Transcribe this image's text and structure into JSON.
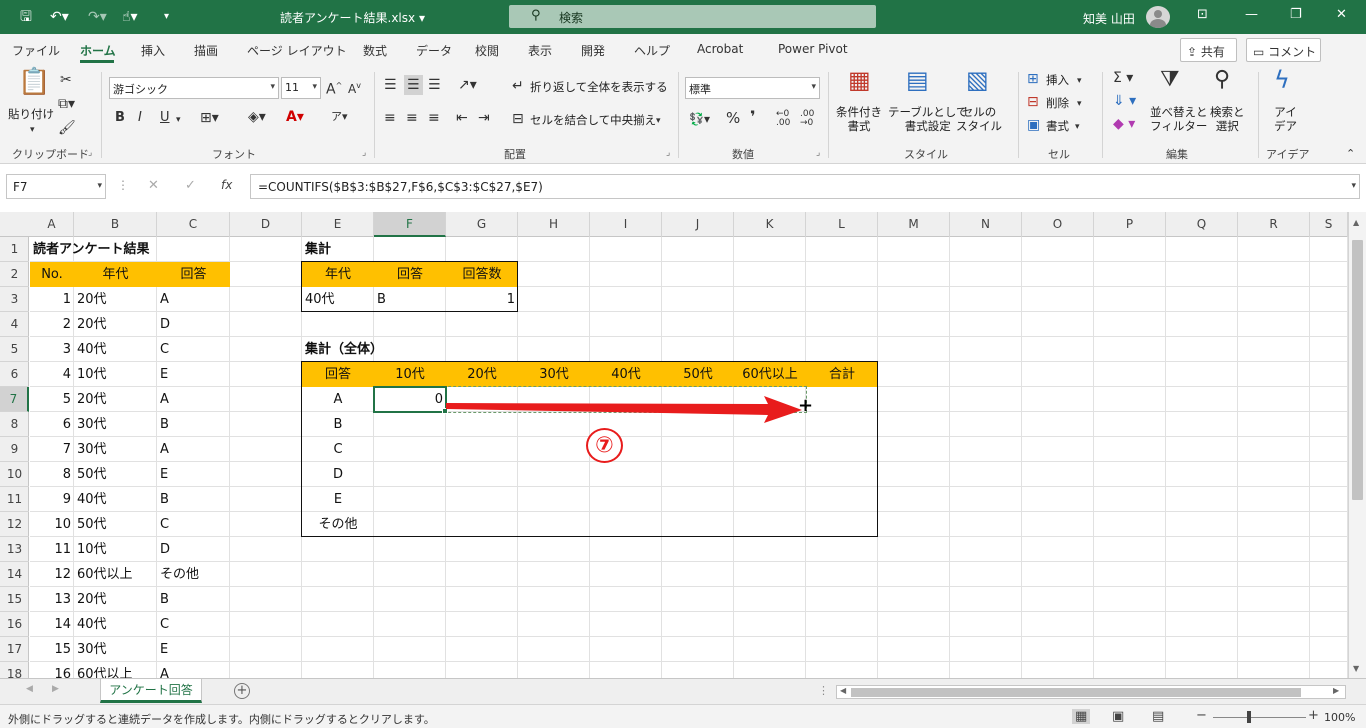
{
  "app": {
    "file_title": "読者アンケート結果.xlsx",
    "user": "知美 山田",
    "search_placeholder": "検索"
  },
  "icons": {
    "save": "save-icon",
    "undo": "undo-icon",
    "redo": "redo-icon",
    "touch": "touch-mode-icon",
    "search": "search-icon"
  },
  "tabs": [
    "ファイル",
    "ホーム",
    "挿入",
    "描画",
    "ページ レイアウト",
    "数式",
    "データ",
    "校閲",
    "表示",
    "開発",
    "ヘルプ",
    "Acrobat",
    "Power Pivot"
  ],
  "active_tab": "ホーム",
  "share_label": "共有",
  "comment_label": "コメント",
  "ribbon": {
    "clipboard": {
      "paste": "貼り付け",
      "label": "クリップボード"
    },
    "font": {
      "name": "游ゴシック",
      "size": "11",
      "label": "フォント"
    },
    "alignment": {
      "wrap": "折り返して全体を表示する",
      "merge": "セルを結合して中央揃え",
      "label": "配置"
    },
    "number": {
      "format": "標準",
      "label": "数値"
    },
    "styles": {
      "cond": "条件付き\n書式",
      "table": "テーブルとして\n書式設定",
      "cell": "セルの\nスタイル",
      "label": "スタイル"
    },
    "cells": {
      "insert": "挿入",
      "delete": "削除",
      "format": "書式",
      "label": "セル"
    },
    "editing": {
      "sort": "並べ替えと\nフィルター",
      "find": "検索と\n選択",
      "label": "編集"
    },
    "ideas": {
      "btn": "アイ\nデア",
      "label": "アイデア"
    }
  },
  "formula": {
    "name_box": "F7",
    "cancel": "✕",
    "enter": "✓",
    "fx": "fx",
    "text": "=COUNTIFS($B$3:$B$27,F$6,$C$3:$C$27,$E7)"
  },
  "columns": [
    "A",
    "B",
    "C",
    "D",
    "E",
    "F",
    "G",
    "H",
    "I",
    "J",
    "K",
    "L",
    "M",
    "N",
    "O",
    "P",
    "Q",
    "R",
    "S"
  ],
  "selected_col": "F",
  "selected_row": "7",
  "rows": [
    "1",
    "2",
    "3",
    "4",
    "5",
    "6",
    "7",
    "8",
    "9",
    "10",
    "11",
    "12",
    "13",
    "14",
    "15",
    "16",
    "17",
    "18"
  ],
  "sheet": {
    "title": "読者アンケート結果",
    "headers": [
      "No.",
      "年代",
      "回答"
    ],
    "data": [
      [
        "1",
        "20代",
        "A"
      ],
      [
        "2",
        "20代",
        "D"
      ],
      [
        "3",
        "40代",
        "C"
      ],
      [
        "4",
        "10代",
        "E"
      ],
      [
        "5",
        "20代",
        "A"
      ],
      [
        "6",
        "30代",
        "B"
      ],
      [
        "7",
        "30代",
        "A"
      ],
      [
        "8",
        "50代",
        "E"
      ],
      [
        "9",
        "40代",
        "B"
      ],
      [
        "10",
        "50代",
        "C"
      ],
      [
        "11",
        "10代",
        "D"
      ],
      [
        "12",
        "60代以上",
        "その他"
      ],
      [
        "13",
        "20代",
        "B"
      ],
      [
        "14",
        "40代",
        "C"
      ],
      [
        "15",
        "30代",
        "E"
      ],
      [
        "16",
        "60代以上",
        "A"
      ]
    ],
    "summary_title": "集計",
    "summary_headers": [
      "年代",
      "回答",
      "回答数"
    ],
    "summary_row": [
      "40代",
      "B",
      "1"
    ],
    "total_title": "集計（全体）",
    "total_headers": [
      "回答",
      "10代",
      "20代",
      "30代",
      "40代",
      "50代",
      "60代以上",
      "合計"
    ],
    "total_labels": [
      "A",
      "B",
      "C",
      "D",
      "E",
      "その他"
    ],
    "f7_value": "0"
  },
  "annotation": {
    "step": "⑦",
    "arrow_color": "#e81c1c",
    "handle_glyph": "+"
  },
  "sheet_tab": "アンケート回答",
  "add_sheet": "+",
  "status": {
    "message": "外側にドラッグすると連続データを作成します。内側にドラッグするとクリアします。",
    "zoom": "100%"
  }
}
